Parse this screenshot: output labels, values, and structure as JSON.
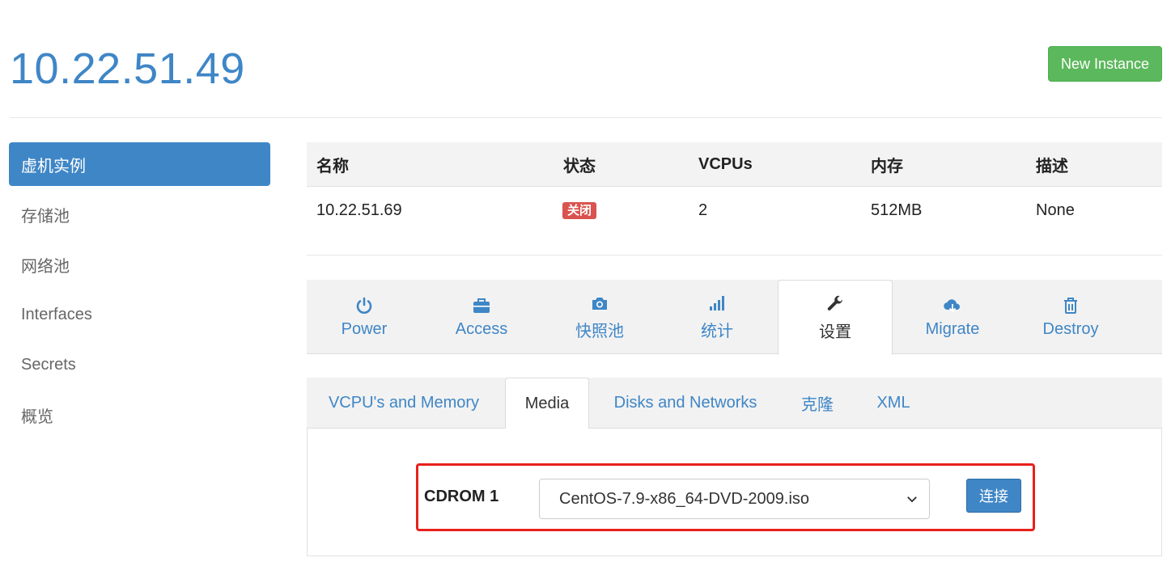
{
  "header": {
    "title": "10.22.51.49",
    "new_instance_label": "New Instance"
  },
  "sidebar": {
    "items": [
      {
        "label": "虚机实例",
        "active": true
      },
      {
        "label": "存储池"
      },
      {
        "label": "网络池"
      },
      {
        "label": "Interfaces"
      },
      {
        "label": "Secrets"
      },
      {
        "label": "概览"
      }
    ]
  },
  "instance_table": {
    "columns": [
      "名称",
      "状态",
      "VCPUs",
      "内存",
      "描述"
    ],
    "row": {
      "name": "10.22.51.69",
      "status": "关闭",
      "vcpus": "2",
      "memory": "512MB",
      "description": "None"
    }
  },
  "action_tabs": [
    {
      "label": "Power",
      "icon": "power-icon"
    },
    {
      "label": "Access",
      "icon": "briefcase-icon"
    },
    {
      "label": "快照池",
      "icon": "camera-icon"
    },
    {
      "label": "统计",
      "icon": "stats-icon"
    },
    {
      "label": "设置",
      "icon": "wrench-icon",
      "active": true
    },
    {
      "label": "Migrate",
      "icon": "cloud-download-icon"
    },
    {
      "label": "Destroy",
      "icon": "trash-icon"
    }
  ],
  "settings_tabs": [
    {
      "label": "VCPU's and Memory"
    },
    {
      "label": "Media",
      "active": true
    },
    {
      "label": "Disks and Networks"
    },
    {
      "label": "克隆"
    },
    {
      "label": "XML"
    }
  ],
  "media": {
    "cdrom_label": "CDROM 1",
    "selected_iso": "CentOS-7.9-x86_64-DVD-2009.iso",
    "connect_label": "连接"
  },
  "colors": {
    "primary": "#3f86c6",
    "success": "#5cb85c",
    "danger": "#d9534f",
    "highlight": "#e8201b"
  }
}
